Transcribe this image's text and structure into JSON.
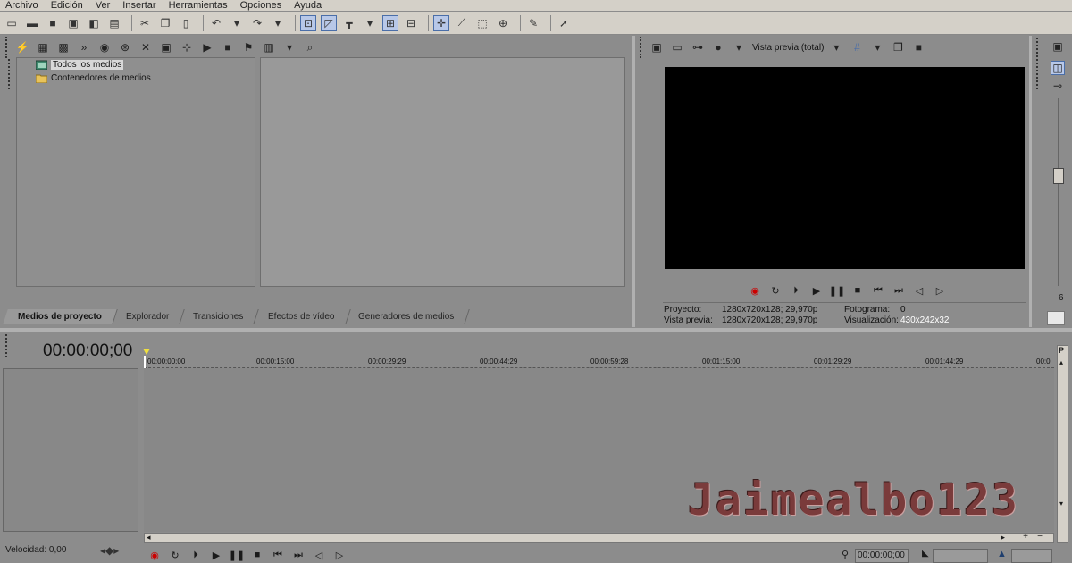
{
  "menu": [
    "Archivo",
    "Edición",
    "Ver",
    "Insertar",
    "Herramientas",
    "Opciones",
    "Ayuda"
  ],
  "media_tree": {
    "items": [
      {
        "label": "Todos los medios"
      },
      {
        "label": "Contenedores de medios"
      }
    ]
  },
  "tabs": [
    "Medios de proyecto",
    "Explorador",
    "Transiciones",
    "Efectos de vídeo",
    "Generadores de medios"
  ],
  "preview": {
    "mode_label": "Vista previa (total)",
    "proyecto_label": "Proyecto:",
    "proyecto_value": "1280x720x128; 29,970p",
    "vista_label": "Vista previa:",
    "vista_value": "1280x720x128; 29,970p",
    "fotograma_label": "Fotograma:",
    "fotograma_value": "0",
    "visualizacion_label": "Visualización:",
    "visualizacion_value": "430x242x32"
  },
  "timeline": {
    "timecode": "00:00:00;00",
    "ruler": [
      "00:00:00:00",
      "00:00:15:00",
      "00:00:29:29",
      "00:00:44:29",
      "00:00:59:28",
      "00:01:15:00",
      "00:01:29:29",
      "00:01:44:29",
      "00:0"
    ],
    "speed": "Velocidad: 0,00",
    "bottom_timecode": "00:00:00;00"
  },
  "watermark": "Jaimealbo123",
  "colors": {
    "accent": "#4a6ea8",
    "record": "#cc0000"
  }
}
